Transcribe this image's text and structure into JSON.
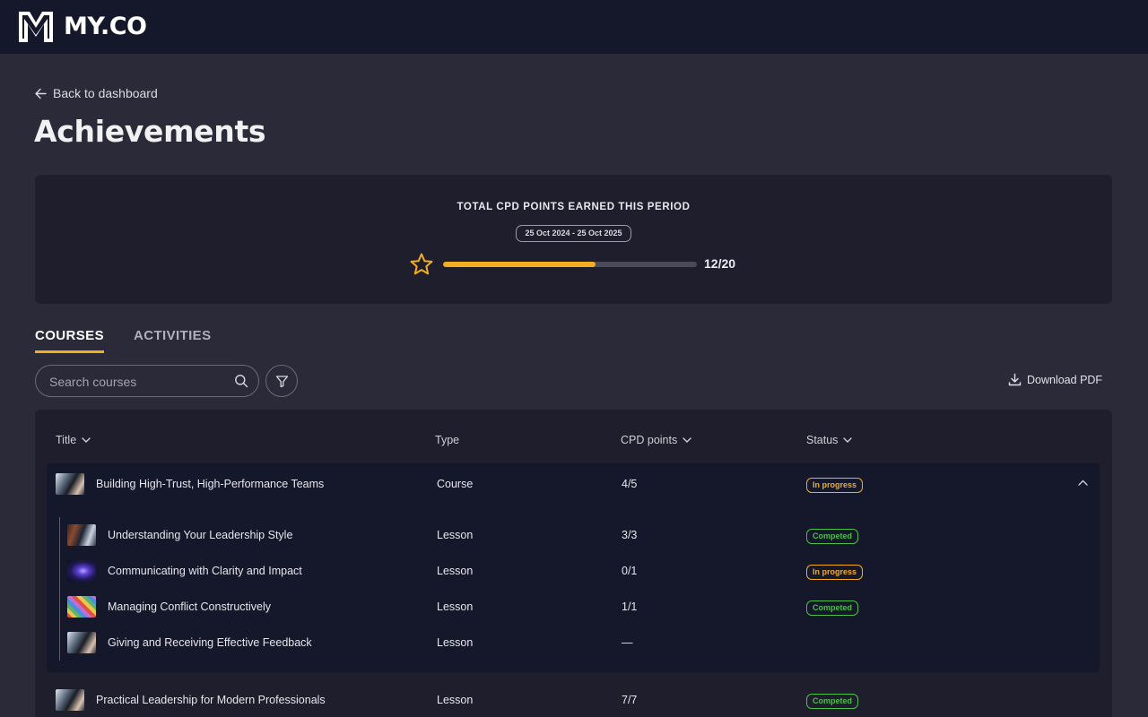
{
  "brand": {
    "name": "MY.CO"
  },
  "nav": {
    "back_label": "Back to dashboard"
  },
  "page": {
    "title": "Achievements"
  },
  "cpd": {
    "heading": "TOTAL CPD POINTS EARNED THIS PERIOD",
    "period": "25 Oct 2024 - 25 Oct 2025",
    "earned": 12,
    "target": 20,
    "display": "12/20",
    "bar_color": "#f4ad21"
  },
  "tabs": [
    {
      "label": "COURSES",
      "active": true
    },
    {
      "label": "ACTIVITIES",
      "active": false
    }
  ],
  "search": {
    "placeholder": "Search courses"
  },
  "toolbar": {
    "download_label": "Download PDF"
  },
  "table": {
    "columns": {
      "title": "Title",
      "type": "Type",
      "cpd": "CPD points",
      "status": "Status"
    },
    "rows": [
      {
        "title": "Building High-Trust, High-Performance Teams",
        "type": "Course",
        "cpd": "4/5",
        "status": "In progress",
        "expanded": true
      },
      {
        "title": "Understanding Your Leadership Style",
        "type": "Lesson",
        "cpd": "3/3",
        "status": "Competed"
      },
      {
        "title": "Communicating with Clarity and Impact",
        "type": "Lesson",
        "cpd": "0/1",
        "status": "In progress"
      },
      {
        "title": "Managing Conflict Constructively",
        "type": "Lesson",
        "cpd": "1/1",
        "status": "Competed"
      },
      {
        "title": "Giving and Receiving Effective Feedback",
        "type": "Lesson",
        "cpd": "—",
        "status": ""
      },
      {
        "title": "Practical Leadership for Modern Professionals",
        "type": "Lesson",
        "cpd": "7/7",
        "status": "Competed"
      }
    ]
  },
  "colors": {
    "accent": "#f4ad21",
    "completed": "#4cc04a",
    "in_progress": "#f4ad21"
  }
}
